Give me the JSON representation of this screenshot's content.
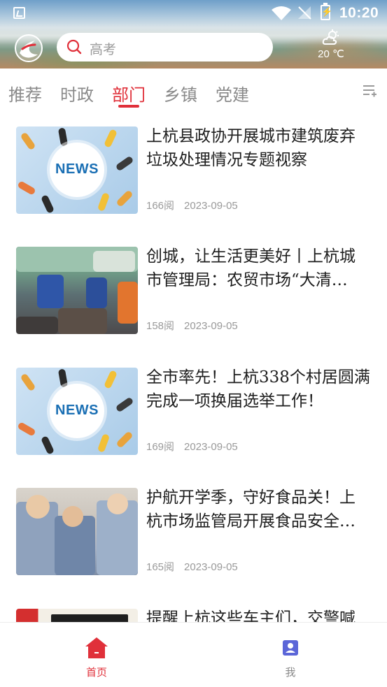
{
  "status_bar": {
    "time": "10:20"
  },
  "header": {
    "search": {
      "placeholder": "高考"
    },
    "weather": {
      "temperature": "20 ℃",
      "icon": "partly-cloudy-icon"
    }
  },
  "tabs": {
    "items": [
      {
        "label": "推荐",
        "active": false
      },
      {
        "label": "时政",
        "active": false
      },
      {
        "label": "部门",
        "active": true
      },
      {
        "label": "乡镇",
        "active": false
      },
      {
        "label": "党建",
        "active": false
      }
    ],
    "menu_icon": "list-add-icon"
  },
  "news": [
    {
      "title": "上杭县政协开展城市建筑废弃垃圾处理情况专题视察",
      "reads": "166阅",
      "date": "2023-09-05",
      "thumb": "news-graphic",
      "thumb_text": "NEWS"
    },
    {
      "title": "创城，让生活更美好丨上杭城市管理局：农贸市场“大清…",
      "reads": "158阅",
      "date": "2023-09-05",
      "thumb": "photo-market"
    },
    {
      "title": "全市率先！上杭338个村居圆满完成一项换届选举工作！",
      "reads": "169阅",
      "date": "2023-09-05",
      "thumb": "news-graphic",
      "thumb_text": "NEWS"
    },
    {
      "title": "护航开学季，守好食品关！上杭市场监管局开展食品安全…",
      "reads": "165阅",
      "date": "2023-09-05",
      "thumb": "photo-inspection"
    },
    {
      "title": "提醒上杭这些车主们，交警喊",
      "reads": "",
      "date": "",
      "thumb": "photo-notice"
    }
  ],
  "bottom_nav": {
    "items": [
      {
        "label": "首页",
        "icon": "home-icon",
        "active": true
      },
      {
        "label": "我",
        "icon": "profile-icon",
        "active": false
      }
    ]
  },
  "colors": {
    "accent": "#e0303a",
    "text_muted": "#8a8a8a",
    "profile_icon": "#5b66d8"
  }
}
